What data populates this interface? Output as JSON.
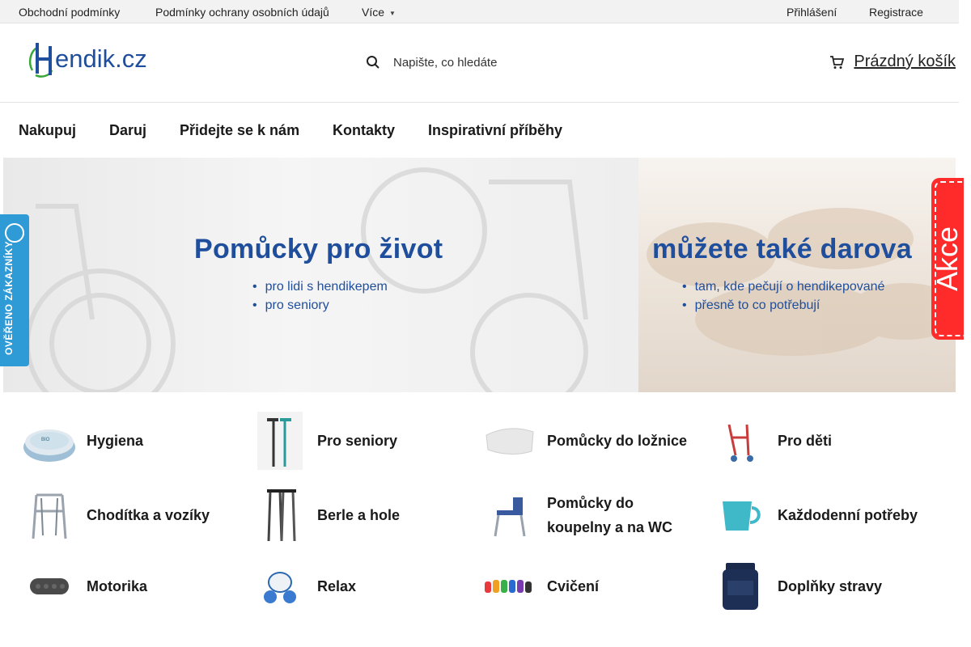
{
  "topbar": {
    "links": [
      "Obchodní podmínky",
      "Podmínky ochrany osobních údajů"
    ],
    "more_label": "Více",
    "login_label": "Přihlášení",
    "register_label": "Registrace"
  },
  "header": {
    "logo_text": "Hendik.cz",
    "search_placeholder": "Napište, co hledáte",
    "cart_label": "Prázdný košík"
  },
  "nav": {
    "items": [
      "Nakupuj",
      "Daruj",
      "Přidejte se k nám",
      "Kontakty",
      "Inspirativní příběhy"
    ]
  },
  "banner": {
    "left": {
      "title": "Pomůcky pro život",
      "bullets": [
        "pro lidi s hendikepem",
        "pro seniory"
      ]
    },
    "right": {
      "title": "můžete také darova",
      "bullets": [
        "tam, kde pečují o hendikepované",
        "přesně to co potřebují"
      ]
    }
  },
  "verified_badge": {
    "seal_text": "OVĚŘENO ZÁKAZNÍKY",
    "label": "OVĚŘENO ZÁKAZNÍKY"
  },
  "promo_tab": {
    "label": "Akce"
  },
  "categories": [
    {
      "name": "Hygiena",
      "icon": "ointment-jar-icon"
    },
    {
      "name": "Pro seniory",
      "icon": "walking-canes-icon"
    },
    {
      "name": "Pomůcky do ložnice",
      "icon": "pillow-icon"
    },
    {
      "name": "Pro děti",
      "icon": "child-cart-icon"
    },
    {
      "name": "Chodítka a vozíky",
      "icon": "walker-icon"
    },
    {
      "name": "Berle a hole",
      "icon": "crutches-icon"
    },
    {
      "name": "Pomůcky do koupelny a na WC",
      "icon": "shower-chair-icon"
    },
    {
      "name": "Každodenní potřeby",
      "icon": "cup-icon"
    },
    {
      "name": "Motorika",
      "icon": "massage-roller-icon"
    },
    {
      "name": "Relax",
      "icon": "massager-icon"
    },
    {
      "name": "Cvičení",
      "icon": "dumbbells-icon"
    },
    {
      "name": "Doplňky stravy",
      "icon": "supplement-jar-icon"
    }
  ],
  "colors": {
    "brand_blue": "#1f4e9c",
    "badge_blue": "#2f9bd6",
    "promo_red": "#ff2a2a",
    "logo_green": "#3aa63a"
  }
}
